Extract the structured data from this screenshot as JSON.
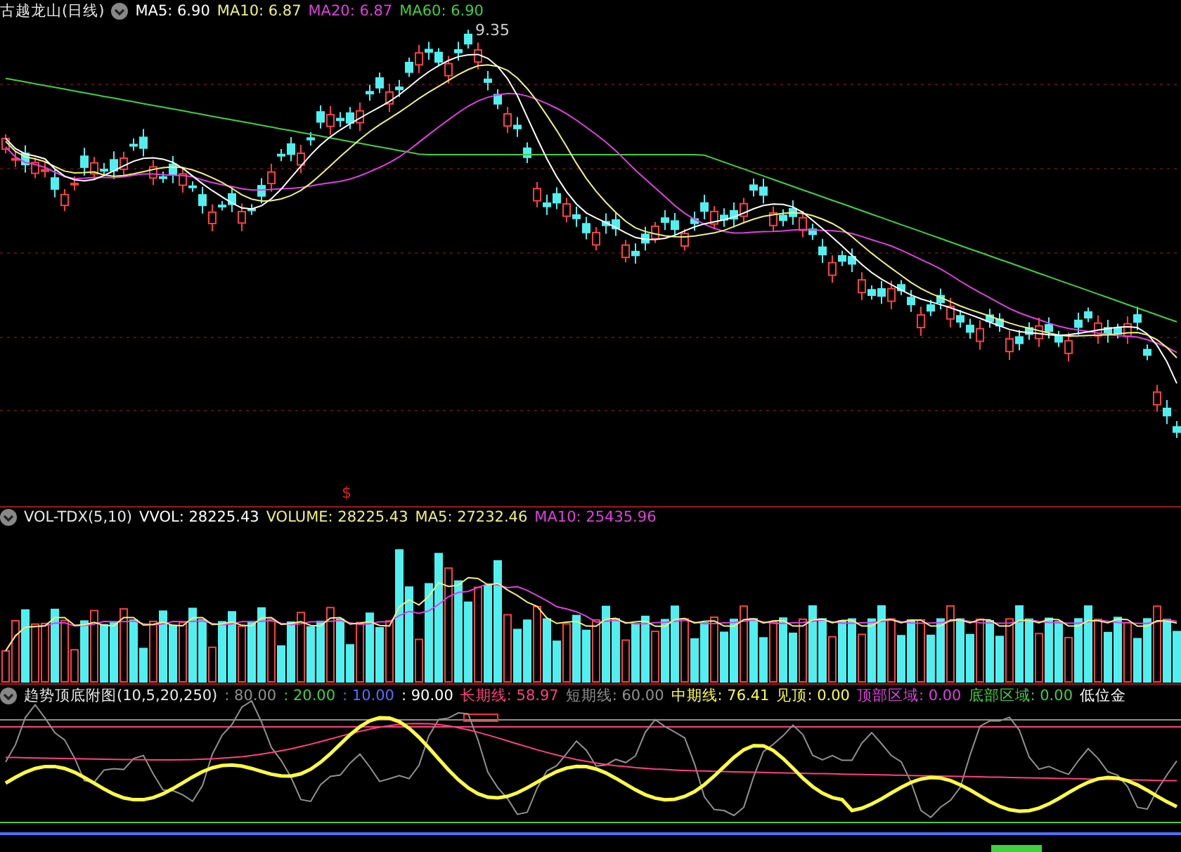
{
  "price_panel": {
    "title": "古越龙山(日线)",
    "indicators": [
      {
        "label": "MA5: 6.90",
        "color": "#ffffff"
      },
      {
        "label": "MA10: 6.87",
        "color": "#f0f080"
      },
      {
        "label": "MA20: 6.87",
        "color": "#e040e0"
      },
      {
        "label": "MA60: 6.90",
        "color": "#40d040"
      }
    ],
    "high_label": "9.35",
    "marker": "$"
  },
  "volume_panel": {
    "title": "VOL-TDX(5,10)",
    "indicators": [
      {
        "label": "VVOL: 28225.43",
        "color": "#ffffff"
      },
      {
        "label": "VOLUME: 28225.43",
        "color": "#f0f080"
      },
      {
        "label": "MA5: 27232.46",
        "color": "#f0f080"
      },
      {
        "label": "MA10: 25435.96",
        "color": "#e040e0"
      }
    ]
  },
  "indicator_panel": {
    "title": "趋势顶底附图(10,5,20,250)",
    "indicators": [
      {
        "label": ": 80.00",
        "color": "#909090"
      },
      {
        "label": ": 20.00",
        "color": "#40d040"
      },
      {
        "label": ": 10.00",
        "color": "#5070ff"
      },
      {
        "label": ": 90.00",
        "color": "#ffffff"
      },
      {
        "label": "长期线: 58.97",
        "color": "#ff4080"
      },
      {
        "label": "短期线: 60.00",
        "color": "#909090"
      },
      {
        "label": "中期线: 76.41",
        "color": "#ffff40"
      },
      {
        "label": "见顶: 0.00",
        "color": "#ffff40"
      },
      {
        "label": "顶部区域: 0.00",
        "color": "#e040e0"
      },
      {
        "label": "底部区域: 0.00",
        "color": "#40d040"
      },
      {
        "label": "低位金",
        "color": "#ffffff"
      }
    ]
  }
}
